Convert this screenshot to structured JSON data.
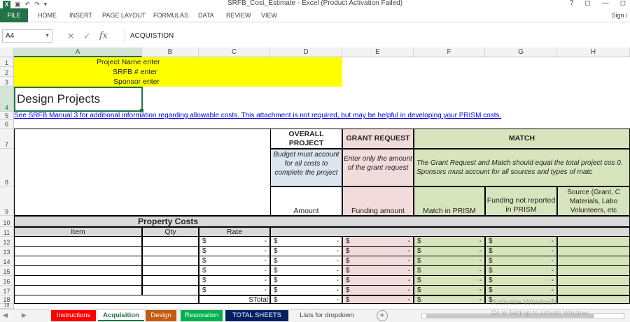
{
  "window": {
    "title": "SRFB_Cost_Estimate - Excel (Product Activation Failed)",
    "help": "?",
    "minimize": "—",
    "restore": "◻"
  },
  "ribbon": {
    "tabs": [
      "FILE",
      "HOME",
      "INSERT",
      "PAGE LAYOUT",
      "FORMULAS",
      "DATA",
      "REVIEW",
      "VIEW"
    ],
    "signin": "Sign i"
  },
  "formula_bar": {
    "name_box": "A4",
    "formula": "ACQUISTION"
  },
  "columns": [
    "A",
    "B",
    "C",
    "D",
    "E",
    "F",
    "G",
    "H"
  ],
  "rows": [
    "1",
    "2",
    "3",
    "4",
    "5",
    "6",
    "7",
    "8",
    "9",
    "10",
    "11",
    "12",
    "13",
    "14",
    "15",
    "16",
    "17",
    "18",
    "19"
  ],
  "sheet": {
    "project_name": "Project Name enter",
    "srfb_num": "SRFB # enter",
    "sponsor": "Sponsor enter",
    "heading": "Design Projects",
    "manual_link": "See SRFB Manual 3 for additional information regarding allowable costs. This attachment is not required, but may be helpful in developing your PRISM costs.",
    "overall_project": "OVERALL PROJECT",
    "grant_request": "GRANT REQUEST",
    "match": "MATCH",
    "overall_note": "Budget must account for all costs to complete the project",
    "grant_note": "Enter only the amount of the grant request",
    "match_note": "The Grant Request and Match should equal the total project cos 0. Sponsors must account for all sources and types of matc",
    "funding_not": "Funding not reported in PRISM",
    "source": "Source (Grant, C Materials, Labo Volunteers, etc",
    "amount": "Amount",
    "funding_amount": "Funding amount",
    "match_prism": "Match in PRISM",
    "property_costs": "Property Costs",
    "item": "Item",
    "qty": "Qty",
    "rate": "Rate",
    "stotal": "STotal",
    "dollar": "$",
    "dash": "-"
  },
  "sheet_tabs": [
    {
      "label": "Instructions",
      "color": "#ff0000"
    },
    {
      "label": "Acquisition",
      "color": "#ffffff"
    },
    {
      "label": "Design",
      "color": "#c55a11"
    },
    {
      "label": "Restoration",
      "color": "#00b050"
    },
    {
      "label": "TOTAL SHEETS 1-3",
      "color": "#002060"
    },
    {
      "label": "Lists for dropdown",
      "color": "#f3f3f3"
    }
  ],
  "watermark": {
    "line1": "Activate Windows",
    "line2": "Go to Settings to activate Windows."
  }
}
